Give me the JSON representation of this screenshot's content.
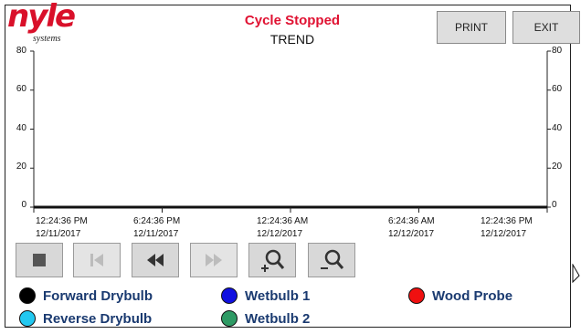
{
  "header": {
    "logo_text": "nyle",
    "logo_sub": "systems",
    "status": "Cycle Stopped",
    "screen_title": "TREND",
    "print_label": "PRINT",
    "exit_label": "EXIT"
  },
  "chart_data": {
    "type": "line",
    "ylim": [
      0,
      80
    ],
    "y_ticks": [
      "80",
      "60",
      "40",
      "20",
      "0"
    ],
    "x_ticks": [
      {
        "time": "12:24:36 PM",
        "date": "12/11/2017"
      },
      {
        "time": "6:24:36 PM",
        "date": "12/11/2017"
      },
      {
        "time": "12:24:36 AM",
        "date": "12/12/2017"
      },
      {
        "time": "6:24:36 AM",
        "date": "12/12/2017"
      },
      {
        "time": "12:24:36 PM",
        "date": "12/12/2017"
      }
    ],
    "series": []
  },
  "controls": [
    {
      "name": "stop",
      "icon": "stop-icon",
      "enabled": true
    },
    {
      "name": "first",
      "icon": "skip-start-icon",
      "enabled": false
    },
    {
      "name": "rewind",
      "icon": "rewind-icon",
      "enabled": true
    },
    {
      "name": "forward",
      "icon": "fast-forward-icon",
      "enabled": false
    },
    {
      "name": "zoom-in",
      "icon": "zoom-in-icon",
      "enabled": true
    },
    {
      "name": "zoom-out",
      "icon": "zoom-out-icon",
      "enabled": true
    }
  ],
  "legend": [
    {
      "label": "Forward Drybulb",
      "color": "#000000"
    },
    {
      "label": "Reverse Drybulb",
      "color": "#22c8f0"
    },
    {
      "label": "Wetbulb 1",
      "color": "#1010e0"
    },
    {
      "label": "Wetbulb 2",
      "color": "#2e9a64"
    },
    {
      "label": "Wood Probe",
      "color": "#f01010"
    }
  ],
  "colors": {
    "status": "#e01232",
    "brand": "#d9102a",
    "legend_text": "#1a3a70"
  }
}
